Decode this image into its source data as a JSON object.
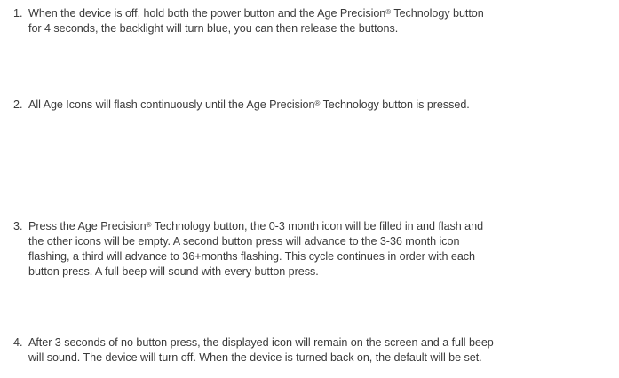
{
  "steps": [
    {
      "number": "1.",
      "lines": [
        [
          "When the device is off, hold both the power button and the Age Precision",
          "®",
          " Technology button"
        ],
        [
          "for 4 seconds, the backlight will turn blue, you can then release the buttons."
        ]
      ]
    },
    {
      "number": "2.",
      "lines": [
        [
          "All Age Icons will flash continuously until the Age Precision",
          "®",
          " Technology button is pressed."
        ]
      ]
    },
    {
      "number": "3.",
      "lines": [
        [
          "Press the Age Precision",
          "®",
          " Technology button, the 0-3 month icon will be filled in and flash and"
        ],
        [
          "the other icons will be empty. A second button press will advance to the 3-36 month icon"
        ],
        [
          "flashing, a third will advance to 36+months flashing. This cycle continues in order with each"
        ],
        [
          "button press. A full beep will sound with every button press."
        ]
      ]
    },
    {
      "number": "4.",
      "lines": [
        [
          "After 3 seconds of no button press, the displayed icon will remain on the screen and a full beep"
        ],
        [
          "will sound. The device will turn off. When the device is turned back on, the default will be set."
        ]
      ]
    }
  ]
}
